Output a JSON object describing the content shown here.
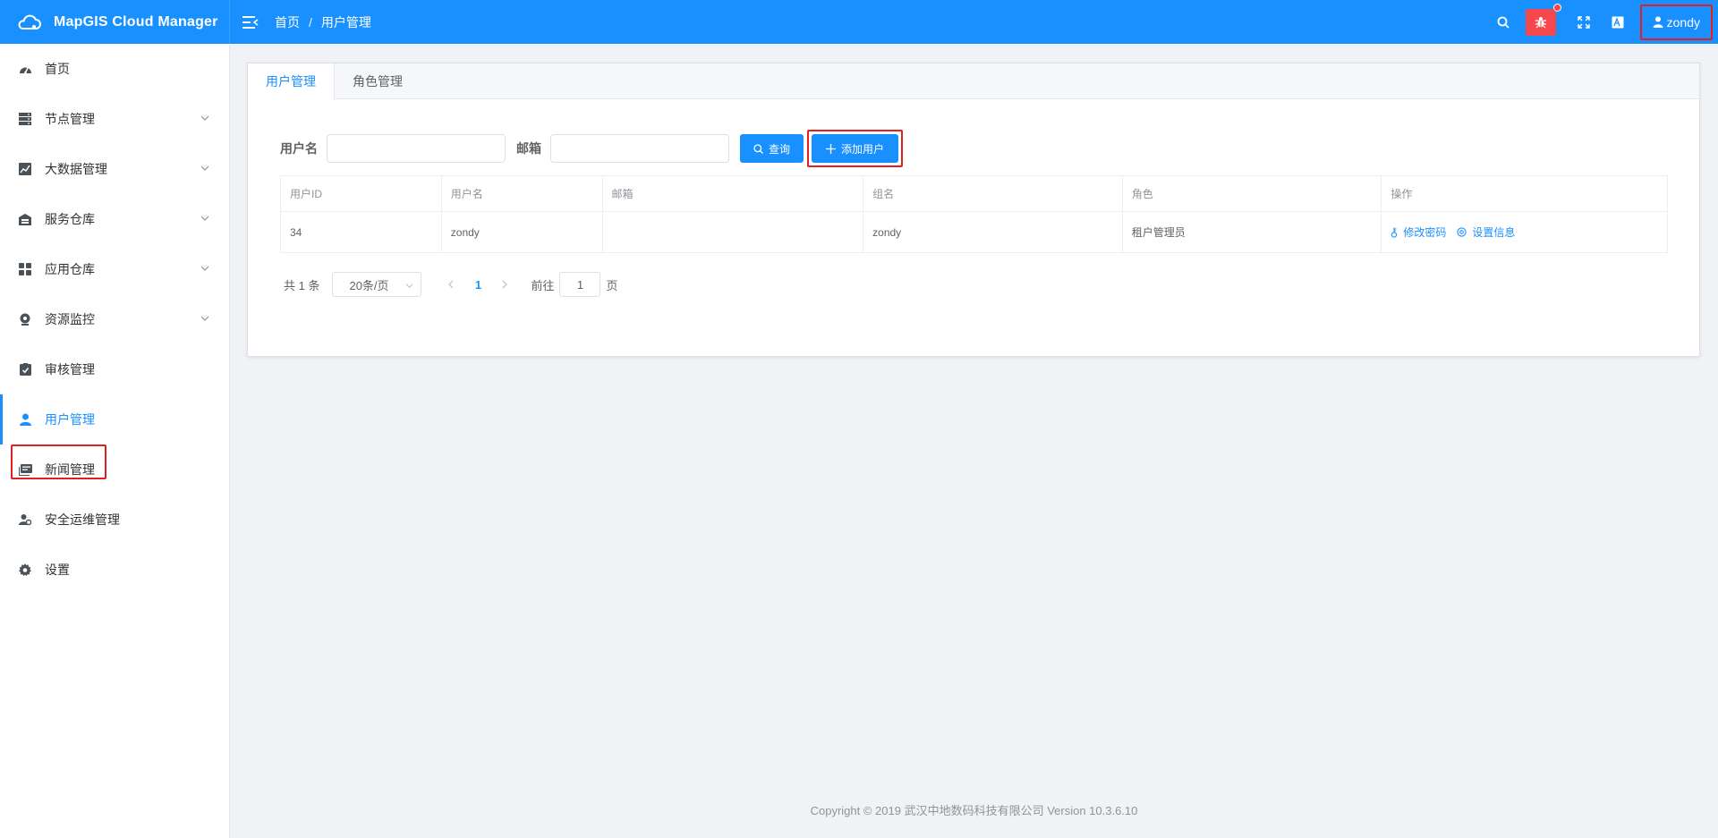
{
  "header": {
    "app_title": "MapGIS Cloud Manager",
    "breadcrumb": [
      "首页",
      "用户管理"
    ],
    "breadcrumb_sep": "/",
    "user_name": "zondy",
    "accent": "#1890ff",
    "bug_color": "#f5474e"
  },
  "sidebar": {
    "items": [
      {
        "label": "首页",
        "icon": "dashboard-icon"
      },
      {
        "label": "节点管理",
        "icon": "server-icon",
        "expandable": true
      },
      {
        "label": "大数据管理",
        "icon": "chart-icon",
        "expandable": true
      },
      {
        "label": "服务仓库",
        "icon": "warehouse-icon",
        "expandable": true
      },
      {
        "label": "应用仓库",
        "icon": "apps-grid-icon",
        "expandable": true
      },
      {
        "label": "资源监控",
        "icon": "monitor-camera-icon",
        "expandable": true
      },
      {
        "label": "审核管理",
        "icon": "audit-check-icon"
      },
      {
        "label": "用户管理",
        "icon": "user-icon",
        "active": true
      },
      {
        "label": "新闻管理",
        "icon": "news-icon"
      },
      {
        "label": "安全运维管理",
        "icon": "security-ops-icon"
      },
      {
        "label": "设置",
        "icon": "gear-icon"
      }
    ]
  },
  "tabs": [
    "用户管理",
    "角色管理"
  ],
  "search": {
    "username_label": "用户名",
    "username_value": "",
    "email_label": "邮箱",
    "email_value": "",
    "query_label": "查询",
    "add_label": "添加用户"
  },
  "table": {
    "columns": [
      "用户ID",
      "用户名",
      "邮箱",
      "组名",
      "角色",
      "操作"
    ],
    "rows": [
      {
        "id": "34",
        "username": "zondy",
        "email": "",
        "group": "zondy",
        "role": "租户管理员",
        "actions": [
          "修改密码",
          "设置信息"
        ]
      }
    ]
  },
  "pagination": {
    "total": "共 1 条",
    "page_size": "20条/页",
    "current_page": "1",
    "goto_prefix": "前往",
    "goto_value": "1",
    "goto_suffix": "页"
  },
  "footer": "Copyright © 2019 武汉中地数码科技有限公司 Version 10.3.6.10"
}
